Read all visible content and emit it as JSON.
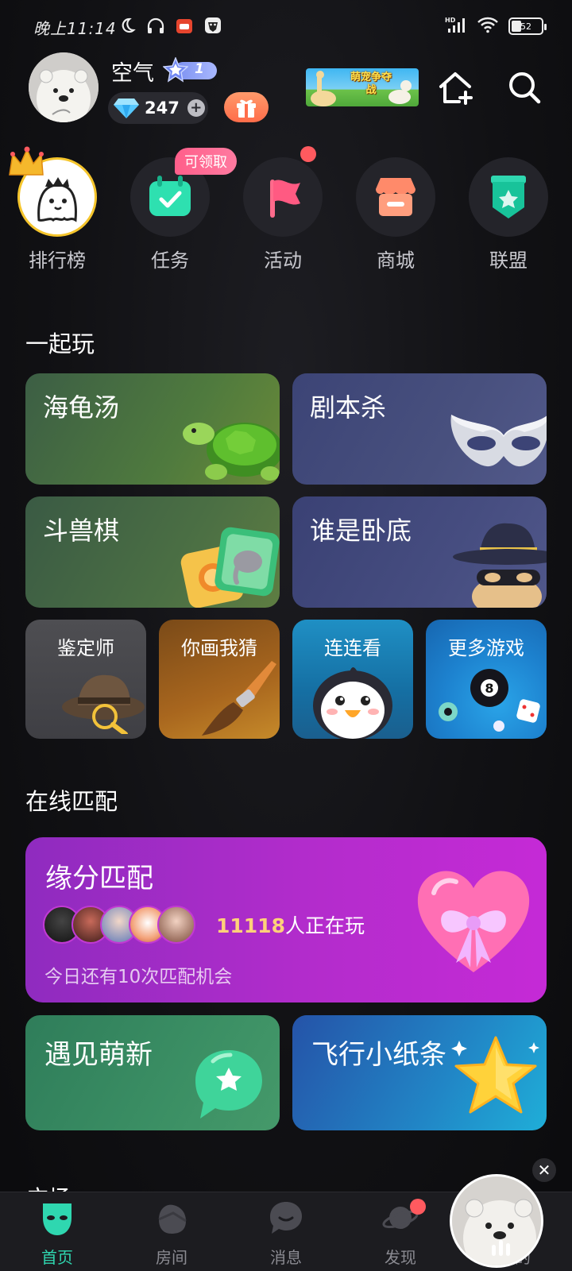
{
  "status_bar": {
    "time": "晚上11:14"
  },
  "profile": {
    "username": "空气",
    "level": "1",
    "diamonds": "247"
  },
  "banner": {
    "text": "萌宠争夺战"
  },
  "quick_actions": [
    {
      "label": "排行榜",
      "icon": "crown-ghost-icon"
    },
    {
      "label": "任务",
      "icon": "task-calendar-icon",
      "badge": "可领取"
    },
    {
      "label": "活动",
      "icon": "flag-icon"
    },
    {
      "label": "商城",
      "icon": "store-icon"
    },
    {
      "label": "联盟",
      "icon": "shield-star-icon"
    }
  ],
  "play_together": {
    "title": "一起玩",
    "games": [
      {
        "label": "海龟汤"
      },
      {
        "label": "剧本杀"
      },
      {
        "label": "斗兽棋"
      },
      {
        "label": "谁是卧底"
      },
      {
        "label": "鉴定师"
      },
      {
        "label": "你画我猜"
      },
      {
        "label": "连连看"
      },
      {
        "label": "更多游戏"
      }
    ]
  },
  "online_match": {
    "title": "在线匹配",
    "match_card": {
      "title": "缘分匹配",
      "player_count": "11118",
      "player_suffix": "人正在玩",
      "subtitle": "今日还有10次匹配机会"
    },
    "features": [
      {
        "label": "遇见萌新"
      },
      {
        "label": "飞行小纸条"
      }
    ]
  },
  "next_section_peek": "广场",
  "bottom_nav": [
    {
      "label": "首页",
      "active": true
    },
    {
      "label": "房间"
    },
    {
      "label": "消息"
    },
    {
      "label": "发现"
    },
    {
      "label": "我的"
    }
  ],
  "colors": {
    "accent": "#2fd7b0",
    "badge_red": "#ff5a5f",
    "match_purple": "#b32ccc"
  }
}
